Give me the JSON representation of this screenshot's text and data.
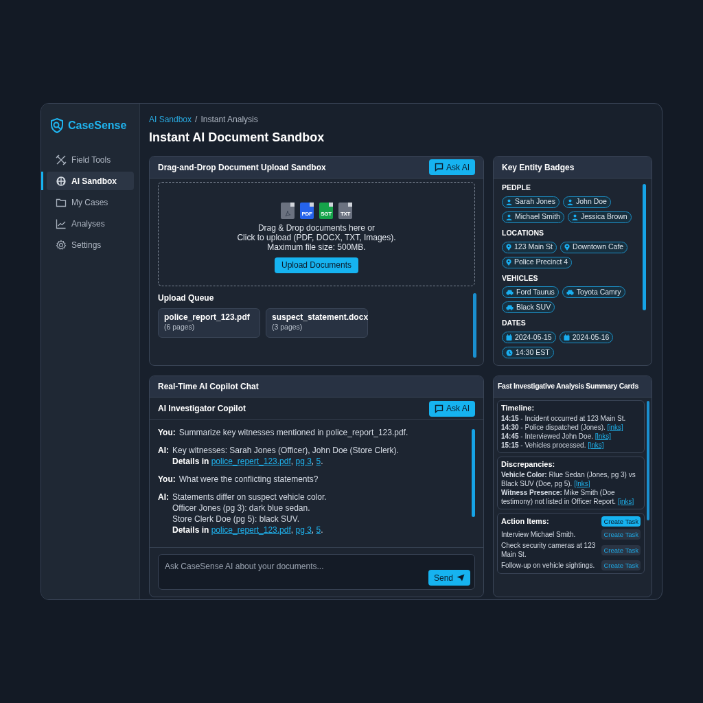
{
  "app": {
    "name": "CaseSense"
  },
  "sidebar": {
    "items": [
      {
        "label": "Field Tools",
        "kind": "tools",
        "selected": false
      },
      {
        "label": "AI Sandbox",
        "kind": "chip",
        "selected": true
      },
      {
        "label": "My Cases",
        "kind": "folder",
        "selected": false
      },
      {
        "label": "Analyses",
        "kind": "chart",
        "selected": false
      },
      {
        "label": "Settings",
        "kind": "gear",
        "selected": false
      }
    ]
  },
  "breadcrumb": {
    "link": "AI Sandbox",
    "separator": "/",
    "current": "Instant Analysis"
  },
  "page_title": "Instant AI Document Sandbox",
  "upload_panel": {
    "title": "Drag-and-Drop Document Upload Sandbox",
    "ask_button": "Ask AI",
    "file_icons": [
      {
        "kind": "acrobat",
        "color": "#6b7280"
      },
      {
        "kind": "labeled",
        "label": "PDF",
        "color": "#2563eb"
      },
      {
        "kind": "labeled",
        "label": "SGT",
        "color": "#16a34a"
      },
      {
        "kind": "labeled",
        "label": "TXT",
        "color": "#6b7280"
      }
    ],
    "drop_text": [
      "Drag & Drop documents here or",
      "Click to upload (PDF, DOCX, TXT, Images).",
      "Maximum file size: 500MB."
    ],
    "upload_button": "Upload Documents",
    "queue_title": "Upload Queue",
    "queue": [
      {
        "name": "police_report_123.pdf",
        "pages": "(6 pages)"
      },
      {
        "name": "suspect_statement.docx",
        "pages": "(3 pages)"
      }
    ]
  },
  "entities_panel": {
    "title": "Key Entity Badges",
    "groups": [
      {
        "label": "PEDPLE",
        "badges": [
          {
            "text": "Sarah Jones",
            "kind": "person"
          },
          {
            "text": "John Doe",
            "kind": "person"
          },
          {
            "text": "Michael Smith",
            "kind": "person"
          },
          {
            "text": "Jessica Brown",
            "kind": "person"
          }
        ]
      },
      {
        "label": "LOCATIONS",
        "badges": [
          {
            "text": "123 Main St",
            "kind": "pin"
          },
          {
            "text": "Downtown Cafe",
            "kind": "pin"
          },
          {
            "text": "Police Precinct 4",
            "kind": "pin"
          }
        ]
      },
      {
        "label": "VEHICLES",
        "badges": [
          {
            "text": "Ford Taurus",
            "kind": "car"
          },
          {
            "text": "Toyota Camry",
            "kind": "car"
          },
          {
            "text": "Black SUV",
            "kind": "car"
          }
        ]
      },
      {
        "label": "DATES",
        "badges": [
          {
            "text": "2024-05-15",
            "kind": "calendar"
          },
          {
            "text": "2024-05-16",
            "kind": "calendar"
          },
          {
            "text": "14:30 EST",
            "kind": "clock"
          }
        ]
      }
    ]
  },
  "chat_panel": {
    "title": "Real-Time AI Copilot Chat",
    "subtitle": "AI Investigator Copilot",
    "ask_button": "Ask AI",
    "messages": [
      {
        "speaker": "You:",
        "lines": [
          "Summarize key witnesses mentioned in police_report_123.pdf."
        ]
      },
      {
        "speaker": "AI:",
        "lines": [
          "Key witnesses: Sarah Jones (Officer), John Doe (Store Clerk)."
        ],
        "details": [
          {
            "kind": "bold",
            "text": "Details in "
          },
          {
            "kind": "link",
            "text": "police_repert_123.pdf"
          },
          {
            "kind": "plain",
            "text": ", "
          },
          {
            "kind": "link",
            "text": "pg 3"
          },
          {
            "kind": "plain",
            "text": ", "
          },
          {
            "kind": "link",
            "text": "5"
          },
          {
            "kind": "plain",
            "text": "."
          }
        ]
      },
      {
        "speaker": "You:",
        "lines": [
          "What were the conflicting statements?"
        ]
      },
      {
        "speaker": "AI:",
        "lines": [
          "Statements differ on suspect vehicle color.",
          "Officer Jones (pg 3): dark blue sedan.",
          "Store Clerk Doe (pg 5): black SUV."
        ],
        "details": [
          {
            "kind": "bold",
            "text": "Details in "
          },
          {
            "kind": "link",
            "text": "police_repert_123.pdf"
          },
          {
            "kind": "plain",
            "text": ", "
          },
          {
            "kind": "link",
            "text": "pg 3"
          },
          {
            "kind": "plain",
            "text": ", "
          },
          {
            "kind": "link",
            "text": "5"
          },
          {
            "kind": "plain",
            "text": "."
          }
        ]
      }
    ],
    "input": {
      "placeholder": "Ask CaseSense AI about your documents..."
    },
    "send_button": "Send"
  },
  "summary_panel": {
    "title": "Fast Investigative Analysis Summary Cards",
    "timeline": {
      "title": "Timeline:",
      "entries": [
        {
          "text": "**14:15** - Incident occurred at 123 Main St."
        },
        {
          "text": "**14:30** - Police dispatched (Jones).",
          "link": "[inks]"
        },
        {
          "text": "**14:45** - Interviewed John Doe.",
          "link": "[lnks]"
        },
        {
          "text": "**15:15** - Vehicles processed.",
          "link": "[lnks]"
        }
      ]
    },
    "discrepancies": {
      "title": "Discrepancies:",
      "entries": [
        {
          "text": "**Vehicle Color:** Rlue Sedan (Jones, pg 3) vs Black SUV (Doe, pg 5).",
          "link": "[lnks]"
        },
        {
          "text": "**Witness Presence:** Mike Smith (Doe testimony) not listed in Officer Report.",
          "link": "[inks]"
        }
      ]
    },
    "actions": {
      "title": "Action Items:",
      "button": "Create Task",
      "highlighted": true,
      "items": [
        {
          "text": "Interview Michael Smith.",
          "button": "Create Task",
          "highlighted": false
        },
        {
          "text": "Check security cameras at 123 Main St.",
          "button": "Create Task",
          "highlighted": false
        },
        {
          "text": "Follow-up on vehicle sightings.",
          "button": "Create Task",
          "highlighted": false
        }
      ]
    }
  }
}
